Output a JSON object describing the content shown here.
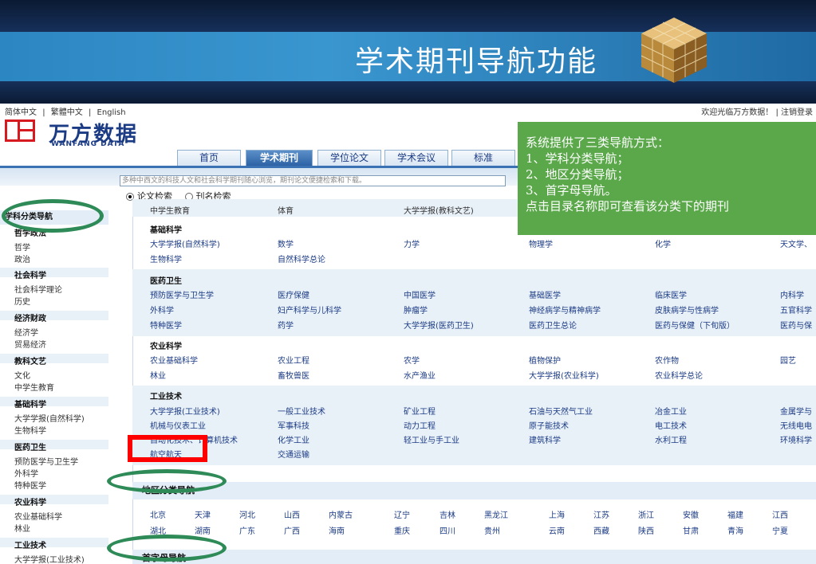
{
  "slide": {
    "title": "学术期刊导航功能"
  },
  "site": {
    "lang": [
      "简体中文",
      "|",
      "繁體中文",
      "|",
      "English"
    ],
    "welcome": "欢迎光临万方数据！ | 注销登录",
    "logo_cn": "万方数据",
    "logo_en": "WANFANG DATA",
    "tabs": [
      "首页",
      "学术期刊",
      "学位论文",
      "学术会议",
      "标准"
    ],
    "search_placeholder": "多种中西文的科技人文和社会科学期刊随心浏览，期刊论文便捷检索和下载。",
    "radio_1": "论文检索",
    "radio_2": "刊名检索"
  },
  "sidebar": {
    "heading": "学科分类导航",
    "cats": {
      "c1": "哲学政法",
      "c2": "社会科学",
      "c3": "经济财政",
      "c4": "教科文艺",
      "c5": "基础科学",
      "c6": "医药卫生",
      "c7": "农业科学",
      "c8": "工业技术"
    },
    "items": {
      "philosophy": "哲学",
      "politics": "政治",
      "social_theory": "社会科学理论",
      "history": "历史",
      "economics": "经济学",
      "trade": "贸易经济",
      "culture": "文化",
      "middle_school": "中学生教育",
      "univ_science": "大学学报(自然科学)",
      "biology": "生物科学",
      "prevention": "预防医学与卫生学",
      "surgery": "外科学",
      "special_med": "特种医学",
      "agri_basic": "农业基础科学",
      "forestry": "林业",
      "univ_eng": "大学学报(工业技术)"
    }
  },
  "main": {
    "top_row": [
      "中学生教育",
      "体育",
      "大学学报(教科文艺)"
    ],
    "sections": {
      "s1": "基础科学",
      "s2": "医药卫生",
      "s3": "农业科学",
      "s4": "工业技术"
    },
    "basic_sci": [
      [
        "大学学报(自然科学)",
        "数学",
        "力学",
        "物理学",
        "化学",
        "天文学、"
      ],
      [
        "生物科学",
        "自然科学总论",
        "",
        "",
        "",
        ""
      ]
    ],
    "medicine": [
      [
        "预防医学与卫生学",
        "医疗保健",
        "中国医学",
        "基础医学",
        "临床医学",
        "内科学"
      ],
      [
        "外科学",
        "妇产科学与儿科学",
        "肿瘤学",
        "神经病学与精神病学",
        "皮肤病学与性病学",
        "五官科学"
      ],
      [
        "特种医学",
        "药学",
        "大学学报(医药卫生)",
        "医药卫生总论",
        "医药与保健（下旬版）",
        "医药与保"
      ]
    ],
    "agriculture": [
      [
        "农业基础科学",
        "农业工程",
        "农学",
        "植物保护",
        "农作物",
        "园艺"
      ],
      [
        "林业",
        "畜牧兽医",
        "水产渔业",
        "大学学报(农业科学)",
        "农业科学总论",
        ""
      ]
    ],
    "industry": [
      [
        "大学学报(工业技术)",
        "一般工业技术",
        "矿业工程",
        "石油与天然气工业",
        "冶金工业",
        "金属学与"
      ],
      [
        "机械与仪表工业",
        "军事科技",
        "动力工程",
        "原子能技术",
        "电工技术",
        "无线电电"
      ],
      [
        "自动化技术、计算机技术",
        "化学工业",
        "轻工业与手工业",
        "建筑科学",
        "水利工程",
        "环境科学"
      ],
      [
        "航空航天",
        "交通运输",
        "",
        "",
        "",
        ""
      ]
    ],
    "region_title": "地区分类导航",
    "regions": [
      [
        "北京",
        "天津",
        "河北",
        "山西",
        "内蒙古",
        "辽宁",
        "吉林",
        "黑龙江",
        "上海",
        "江苏",
        "浙江",
        "安徽",
        "福建",
        "江西"
      ],
      [
        "湖北",
        "湖南",
        "广东",
        "广西",
        "海南",
        "重庆",
        "四川",
        "贵州",
        "云南",
        "西藏",
        "陕西",
        "甘肃",
        "青海",
        "宁夏"
      ]
    ],
    "alpha_title": "首字母导航"
  },
  "callout": {
    "line1": "系统提供了三类导航方式：",
    "line2": "1、学科分类导航；",
    "line3": "2、地区分类导航；",
    "line4": "3、首字母导航。",
    "line5": "点击目录名称即可查看该分类下的期刊"
  },
  "colors": {
    "callout": "#5aa84a",
    "ellipse": "#2e8b57",
    "highlight": "#ff0000",
    "nav": "#3a72b4"
  }
}
